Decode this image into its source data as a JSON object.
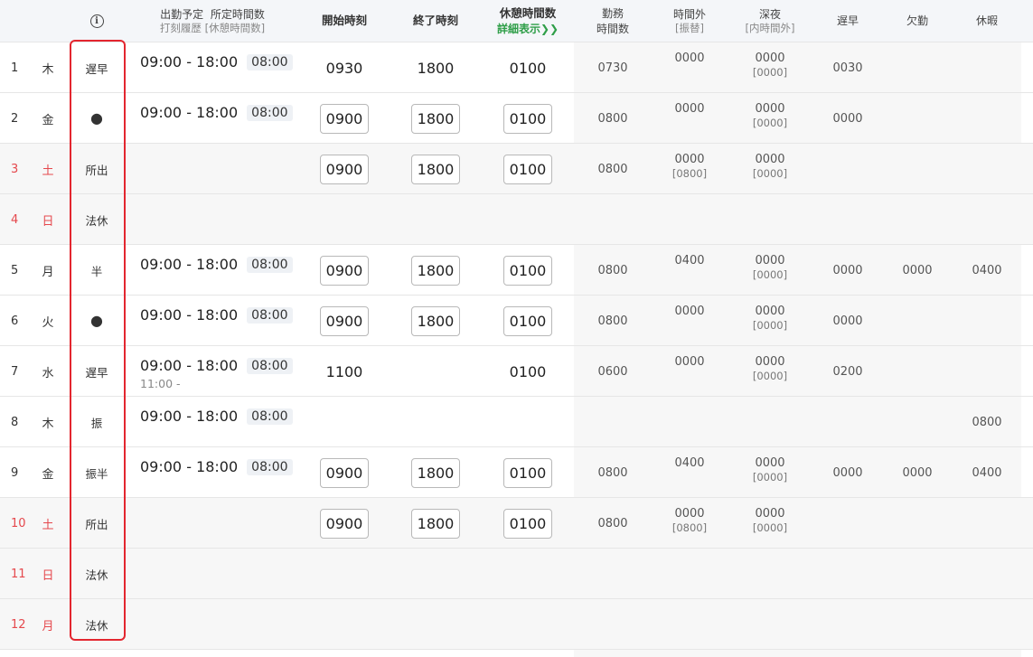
{
  "header": {
    "info_symbol": "i",
    "plan_title": "出勤予定",
    "plan_hours_title": "所定時間数",
    "plan_sub": "打刻履歴 [休憩時間数]",
    "start_title": "開始時刻",
    "end_title": "終了時刻",
    "rest_title": "休憩時間数",
    "rest_detail_link": "詳細表示",
    "work_title1": "勤務",
    "work_title2": "時間数",
    "overtime_title": "時間外",
    "overtime_sub": "[振替]",
    "night_title": "深夜",
    "night_sub": "[内時間外]",
    "late_title": "遅早",
    "absence_title": "欠勤",
    "leave_title": "休暇"
  },
  "rows": [
    {
      "day": "1",
      "dow": "木",
      "weekend": false,
      "type": "遅早",
      "plan": "09:00 - 18:00",
      "plan_hours": "08:00",
      "history": "",
      "start": "0930",
      "end": "1800",
      "rest": "0100",
      "boxed": false,
      "work": "0730",
      "ot": "0000",
      "ot_sub": "",
      "night": "0000",
      "night_sub": "[0000]",
      "late": "0030",
      "absence": "",
      "leave": ""
    },
    {
      "day": "2",
      "dow": "金",
      "weekend": false,
      "type": "●",
      "plan": "09:00 - 18:00",
      "plan_hours": "08:00",
      "history": "",
      "start": "0900",
      "end": "1800",
      "rest": "0100",
      "boxed": true,
      "work": "0800",
      "ot": "0000",
      "ot_sub": "",
      "night": "0000",
      "night_sub": "[0000]",
      "late": "0000",
      "absence": "",
      "leave": ""
    },
    {
      "day": "3",
      "dow": "土",
      "weekend": true,
      "type": "所出",
      "plan": "",
      "plan_hours": "",
      "history": "",
      "start": "0900",
      "end": "1800",
      "rest": "0100",
      "boxed": true,
      "work": "0800",
      "ot": "0000",
      "ot_sub": "[0800]",
      "night": "0000",
      "night_sub": "[0000]",
      "late": "",
      "absence": "",
      "leave": ""
    },
    {
      "day": "4",
      "dow": "日",
      "weekend": true,
      "type": "法休",
      "plan": "",
      "plan_hours": "",
      "history": "",
      "start": "",
      "end": "",
      "rest": "",
      "boxed": false,
      "work": "",
      "ot": "",
      "ot_sub": "",
      "night": "",
      "night_sub": "",
      "late": "",
      "absence": "",
      "leave": ""
    },
    {
      "day": "5",
      "dow": "月",
      "weekend": false,
      "type": "半",
      "plan": "09:00 - 18:00",
      "plan_hours": "08:00",
      "history": "",
      "start": "0900",
      "end": "1800",
      "rest": "0100",
      "boxed": true,
      "work": "0800",
      "ot": "0400",
      "ot_sub": "",
      "night": "0000",
      "night_sub": "[0000]",
      "late": "0000",
      "absence": "0000",
      "leave": "0400"
    },
    {
      "day": "6",
      "dow": "火",
      "weekend": false,
      "type": "●",
      "plan": "09:00 - 18:00",
      "plan_hours": "08:00",
      "history": "",
      "start": "0900",
      "end": "1800",
      "rest": "0100",
      "boxed": true,
      "work": "0800",
      "ot": "0000",
      "ot_sub": "",
      "night": "0000",
      "night_sub": "[0000]",
      "late": "0000",
      "absence": "",
      "leave": ""
    },
    {
      "day": "7",
      "dow": "水",
      "weekend": false,
      "type": "遅早",
      "plan": "09:00 - 18:00",
      "plan_hours": "08:00",
      "history": "11:00  -",
      "start": "1100",
      "end": "",
      "rest": "0100",
      "boxed": false,
      "work": "0600",
      "ot": "0000",
      "ot_sub": "",
      "night": "0000",
      "night_sub": "[0000]",
      "late": "0200",
      "absence": "",
      "leave": ""
    },
    {
      "day": "8",
      "dow": "木",
      "weekend": false,
      "type": "振",
      "plan": "09:00 - 18:00",
      "plan_hours": "08:00",
      "history": "",
      "start": "",
      "end": "",
      "rest": "",
      "boxed": false,
      "work": "",
      "ot": "",
      "ot_sub": "",
      "night": "",
      "night_sub": "",
      "late": "",
      "absence": "",
      "leave": "0800"
    },
    {
      "day": "9",
      "dow": "金",
      "weekend": false,
      "type": "振半",
      "plan": "09:00 - 18:00",
      "plan_hours": "08:00",
      "history": "",
      "start": "0900",
      "end": "1800",
      "rest": "0100",
      "boxed": true,
      "work": "0800",
      "ot": "0400",
      "ot_sub": "",
      "night": "0000",
      "night_sub": "[0000]",
      "late": "0000",
      "absence": "0000",
      "leave": "0400"
    },
    {
      "day": "10",
      "dow": "土",
      "weekend": true,
      "type": "所出",
      "plan": "",
      "plan_hours": "",
      "history": "",
      "start": "0900",
      "end": "1800",
      "rest": "0100",
      "boxed": true,
      "work": "0800",
      "ot": "0000",
      "ot_sub": "[0800]",
      "night": "0000",
      "night_sub": "[0000]",
      "late": "",
      "absence": "",
      "leave": ""
    },
    {
      "day": "11",
      "dow": "日",
      "weekend": true,
      "type": "法休",
      "plan": "",
      "plan_hours": "",
      "history": "",
      "start": "",
      "end": "",
      "rest": "",
      "boxed": false,
      "work": "",
      "ot": "",
      "ot_sub": "",
      "night": "",
      "night_sub": "",
      "late": "",
      "absence": "",
      "leave": ""
    },
    {
      "day": "12",
      "dow": "月",
      "weekend": true,
      "type": "法休",
      "plan": "",
      "plan_hours": "",
      "history": "",
      "start": "",
      "end": "",
      "rest": "",
      "boxed": false,
      "work": "",
      "ot": "",
      "ot_sub": "",
      "night": "",
      "night_sub": "",
      "late": "",
      "absence": "",
      "leave": ""
    }
  ],
  "colors": {
    "weekend_text": "#e5484d",
    "highlight_border": "#e3262f",
    "detail_link": "#2e9e48"
  }
}
